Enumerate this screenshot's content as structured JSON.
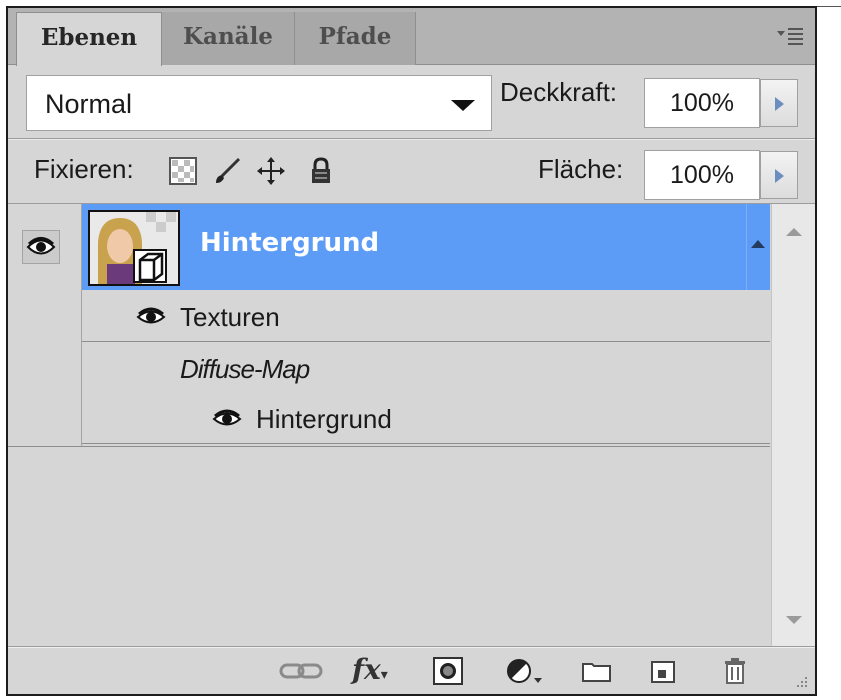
{
  "tabs": [
    {
      "label": "Ebenen",
      "active": true
    },
    {
      "label": "Kanäle",
      "active": false
    },
    {
      "label": "Pfade",
      "active": false
    }
  ],
  "blend": {
    "mode": "Normal"
  },
  "opacity": {
    "label": "Deckkraft:",
    "value": "100%"
  },
  "lock": {
    "label": "Fixieren:",
    "icons": [
      "transparent-pixels-lock-icon",
      "paintbrush-lock-icon",
      "move-lock-icon",
      "padlock-icon"
    ]
  },
  "fill": {
    "label": "Fläche:",
    "value": "100%"
  },
  "layers": {
    "selected": {
      "name": "Hintergrund",
      "visible": true
    },
    "textures": {
      "label": "Texturen"
    },
    "diffuse": {
      "label": "Diffuse-Map"
    },
    "diffuse_layer": {
      "label": "Hintergrund"
    }
  },
  "toolbar": {
    "buttons": [
      "link-layers-icon",
      "fx-icon",
      "layer-mask-icon",
      "adjustment-layer-icon",
      "group-folder-icon",
      "new-layer-icon",
      "trash-icon"
    ],
    "fx_label": "fx"
  },
  "colors": {
    "selection": "#5d9cf6",
    "panel_bg": "#d6d6d6",
    "tab_inactive": "#a8a8a8"
  }
}
